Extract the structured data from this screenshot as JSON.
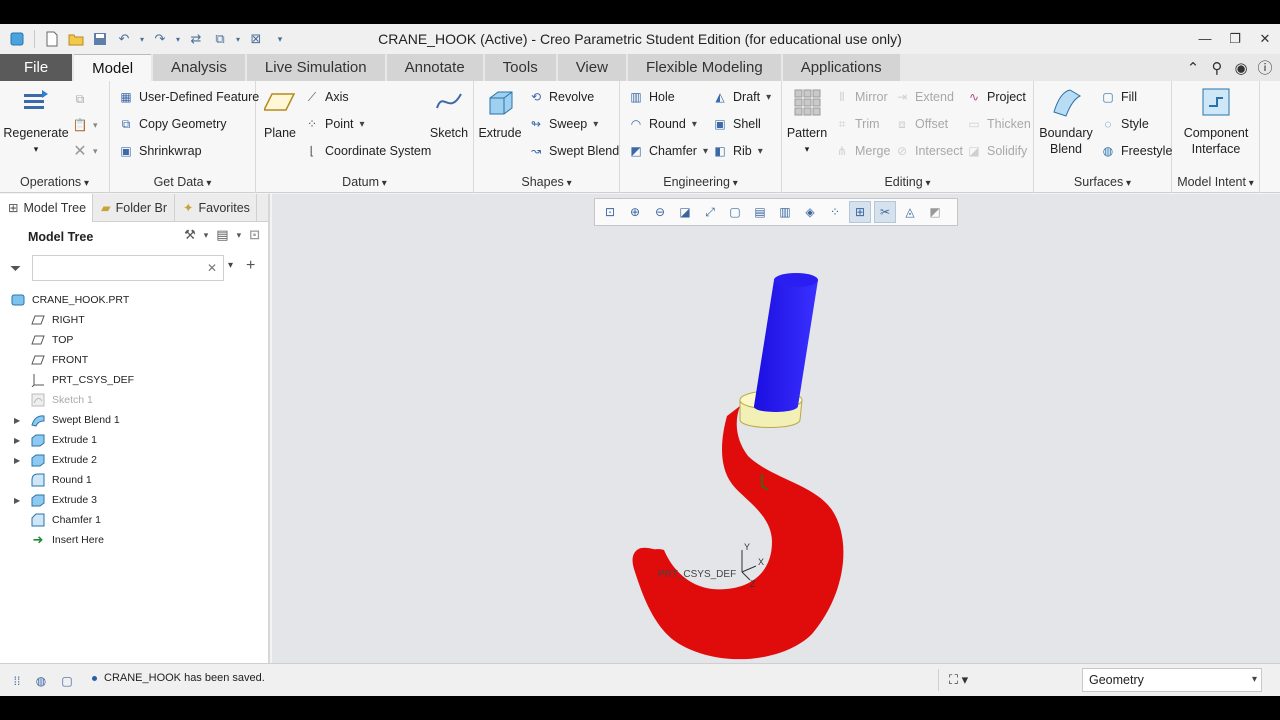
{
  "window": {
    "title": "CRANE_HOOK (Active) - Creo Parametric Student Edition (for educational use only)"
  },
  "menu_tabs": [
    "File",
    "Model",
    "Analysis",
    "Live Simulation",
    "Annotate",
    "Tools",
    "View",
    "Flexible Modeling",
    "Applications"
  ],
  "ribbon": {
    "operations": {
      "label": "Operations",
      "regenerate": "Regenerate"
    },
    "get_data": {
      "label": "Get Data",
      "items": [
        "User-Defined Feature",
        "Copy Geometry",
        "Shrinkwrap"
      ]
    },
    "datum": {
      "label": "Datum",
      "plane": "Plane",
      "axis": "Axis",
      "point": "Point",
      "csys": "Coordinate System",
      "sketch": "Sketch"
    },
    "shapes": {
      "label": "Shapes",
      "extrude": "Extrude",
      "revolve": "Revolve",
      "sweep": "Sweep",
      "swept_blend": "Swept Blend"
    },
    "engineering": {
      "label": "Engineering",
      "hole": "Hole",
      "round": "Round",
      "chamfer": "Chamfer",
      "draft": "Draft",
      "shell": "Shell",
      "rib": "Rib"
    },
    "editing": {
      "label": "Editing",
      "pattern": "Pattern",
      "mirror": "Mirror",
      "trim": "Trim",
      "merge": "Merge",
      "extend": "Extend",
      "offset": "Offset",
      "intersect": "Intersect",
      "project": "Project",
      "thicken": "Thicken",
      "solidify": "Solidify"
    },
    "surfaces": {
      "label": "Surfaces",
      "boundary_blend": "Boundary Blend",
      "fill": "Fill",
      "style": "Style",
      "freestyle": "Freestyle"
    },
    "model_intent": {
      "label": "Model Intent",
      "component_interface": "Component Interface"
    }
  },
  "panel": {
    "tabs": [
      "Model Tree",
      "Folder Br",
      "Favorites"
    ],
    "header": "Model Tree",
    "filter_placeholder": "",
    "tree": [
      {
        "label": "CRANE_HOOK.PRT",
        "icon": "part-icon",
        "level": 0
      },
      {
        "label": "RIGHT",
        "icon": "datum-plane-icon",
        "level": 1
      },
      {
        "label": "TOP",
        "icon": "datum-plane-icon",
        "level": 1
      },
      {
        "label": "FRONT",
        "icon": "datum-plane-icon",
        "level": 1
      },
      {
        "label": "PRT_CSYS_DEF",
        "icon": "csys-icon",
        "level": 1
      },
      {
        "label": "Sketch 1",
        "icon": "sketch-icon",
        "level": 1,
        "hidden": true
      },
      {
        "label": "Swept Blend 1",
        "icon": "swept-blend-icon",
        "level": 1,
        "expandable": true
      },
      {
        "label": "Extrude 1",
        "icon": "extrude-icon",
        "level": 1,
        "expandable": true
      },
      {
        "label": "Extrude 2",
        "icon": "extrude-icon",
        "level": 1,
        "expandable": true
      },
      {
        "label": "Round 1",
        "icon": "round-icon",
        "level": 1
      },
      {
        "label": "Extrude 3",
        "icon": "extrude-icon",
        "level": 1,
        "expandable": true
      },
      {
        "label": "Chamfer 1",
        "icon": "chamfer-icon",
        "level": 1
      },
      {
        "label": "Insert Here",
        "icon": "insert-arrow-icon",
        "level": 1
      }
    ]
  },
  "viewport": {
    "csys_label": "PRT_CSYS_DEF",
    "axis_x": "X",
    "axis_y": "Y",
    "axis_z": "Z",
    "colors": {
      "shank": "#1a0fe0",
      "collar": "#f2f0b4",
      "hook": "#e00c0c"
    }
  },
  "status": {
    "message": "CRANE_HOOK has been saved.",
    "filter_value": "Geometry"
  }
}
